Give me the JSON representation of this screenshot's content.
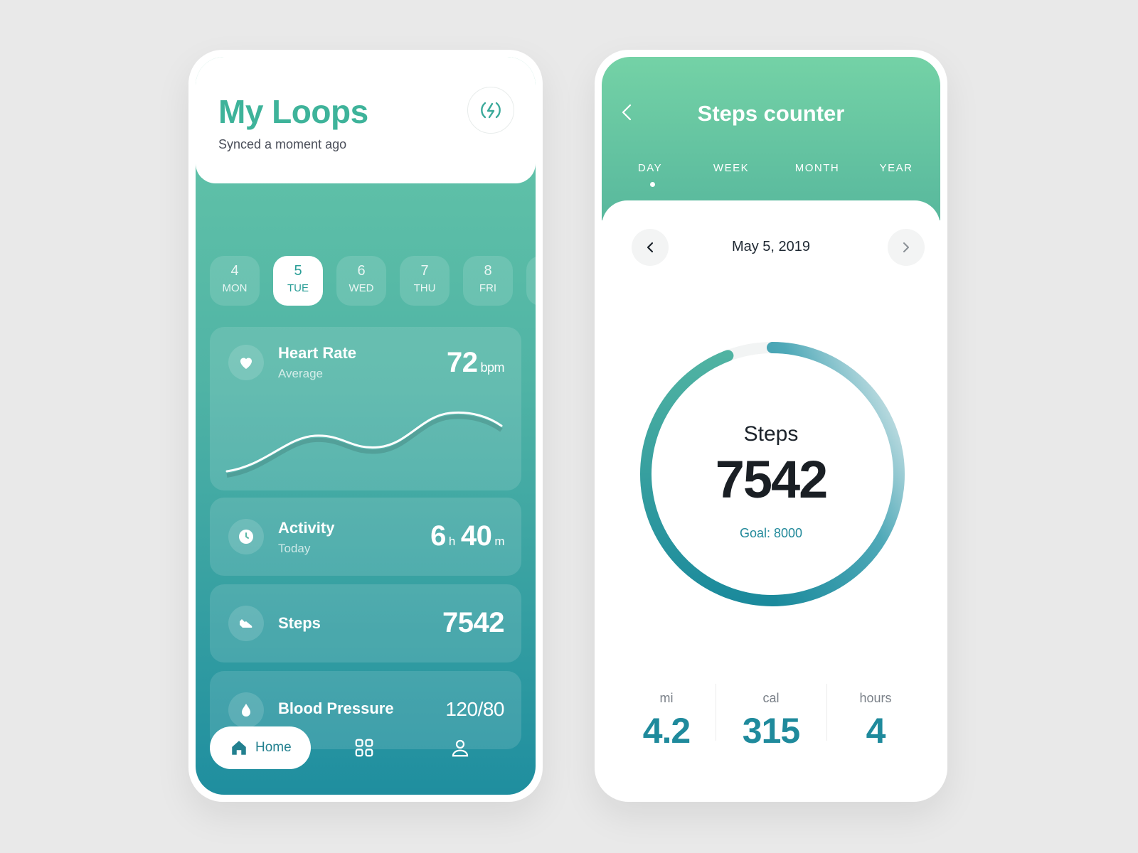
{
  "loops": {
    "title": "My Loops",
    "subtitle": "Synced a moment ago",
    "sync_icon": "lightning-sync-icon",
    "days": [
      {
        "num": "4",
        "name": "MON",
        "active": false
      },
      {
        "num": "5",
        "name": "TUE",
        "active": true
      },
      {
        "num": "6",
        "name": "WED",
        "active": false
      },
      {
        "num": "7",
        "name": "THU",
        "active": false
      },
      {
        "num": "8",
        "name": "FRI",
        "active": false
      }
    ],
    "heart_rate": {
      "title": "Heart Rate",
      "sub": "Average",
      "value": "72",
      "unit": "bpm",
      "icon": "heart-icon"
    },
    "activity": {
      "title": "Activity",
      "sub": "Today",
      "hours": "6",
      "hours_unit": "h",
      "minutes": "40",
      "minutes_unit": "m",
      "icon": "clock-icon"
    },
    "steps": {
      "title": "Steps",
      "value": "7542",
      "icon": "sneaker-icon"
    },
    "blood_pressure": {
      "title": "Blood Pressure",
      "value": "120/80",
      "icon": "drop-icon"
    },
    "nav": {
      "home_label": "Home",
      "icons": [
        "home-icon",
        "grid-icon",
        "user-icon"
      ]
    }
  },
  "counter": {
    "title": "Steps counter",
    "tabs": [
      "DAY",
      "WEEK",
      "MONTH",
      "YEAR"
    ],
    "active_tab": "DAY",
    "date": "May 5, 2019",
    "ring_label": "Steps",
    "steps_value": "7542",
    "goal_label": "Goal: 8000",
    "progress": 0.9428,
    "stats": [
      {
        "label": "mi",
        "value": "4.2"
      },
      {
        "label": "cal",
        "value": "315"
      },
      {
        "label": "hours",
        "value": "4"
      }
    ]
  },
  "colors": {
    "brand_green": "#3eb39a",
    "gradient_top": "#67c7a9",
    "gradient_bottom": "#1f8e9f",
    "accent_teal": "#1f8a9c",
    "background": "#e9e9e9"
  }
}
